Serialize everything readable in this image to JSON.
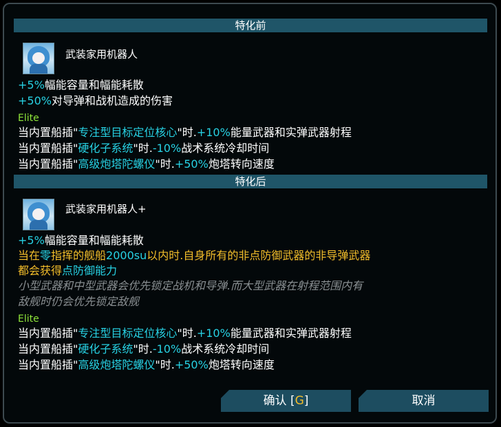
{
  "before": {
    "header": "特化前",
    "name": "武装家用机器人",
    "line1": {
      "value": "+5%",
      "text": "幅能容量和幅能耗散"
    },
    "line2": {
      "value": "+50%",
      "text": "对导弹和战机造成的伤害"
    },
    "elite": "Elite",
    "e1": {
      "a": "当内置船插\"",
      "hl": "专注型目标定位核心",
      "b": "\"时.",
      "val": "+10%",
      "c": "能量武器和实弹武器射程"
    },
    "e2": {
      "a": "当内置船插\"",
      "hl": "硬化子系统",
      "b": "\"时.",
      "val": "-10%",
      "c": "战术系统冷却时间"
    },
    "e3": {
      "a": "当内置船插\"",
      "hl": "高级炮塔陀螺仪",
      "b": "\"时.",
      "val": "+50%",
      "c": "炮塔转向速度"
    }
  },
  "after": {
    "header": "特化后",
    "name": "武装家用机器人+",
    "line1": {
      "value": "+5%",
      "text": "幅能容量和幅能耗散"
    },
    "y1": {
      "a": "当在",
      "b": "零",
      "c": "指挥的舰船",
      "d": "2000su",
      "e": "以内时.自身所有的非点防御武器的非导弹武器"
    },
    "y2": {
      "a": "都会获得",
      "b": "点防御能力"
    },
    "g1": "小型武器和中型武器会优先锁定战机和导弹.而大型武器在射程范围内有",
    "g2": "敌舰时仍会优先锁定敌舰",
    "elite": "Elite",
    "e1": {
      "a": "当内置船插\"",
      "hl": "专注型目标定位核心",
      "b": "\"时.",
      "val": "+10%",
      "c": "能量武器和实弹武器射程"
    },
    "e2": {
      "a": "当内置船插\"",
      "hl": "硬化子系统",
      "b": "\"时.",
      "val": "-10%",
      "c": "战术系统冷却时间"
    },
    "e3": {
      "a": "当内置船插\"",
      "hl": "高级炮塔陀螺仪",
      "b": "\"时.",
      "val": "+50%",
      "c": "炮塔转向速度"
    }
  },
  "buttons": {
    "confirm_label": "确认 [",
    "confirm_key": "G",
    "confirm_close": "]",
    "cancel_label": "取消"
  }
}
